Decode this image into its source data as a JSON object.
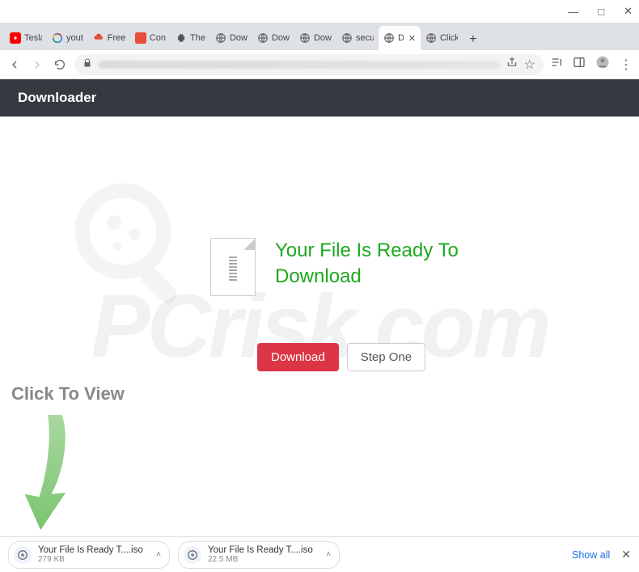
{
  "window": {
    "controls": {
      "min": "—",
      "max": "□",
      "close": "✕"
    }
  },
  "tabs": [
    {
      "title": "Tesla",
      "icon": "youtube"
    },
    {
      "title": "yout",
      "icon": "google"
    },
    {
      "title": "Free",
      "icon": "red-cloud"
    },
    {
      "title": "Con",
      "icon": "red-square"
    },
    {
      "title": "The",
      "icon": "printer"
    },
    {
      "title": "Dow",
      "icon": "globe"
    },
    {
      "title": "Dow",
      "icon": "globe"
    },
    {
      "title": "Dow",
      "icon": "globe"
    },
    {
      "title": "secu",
      "icon": "globe"
    },
    {
      "title": "D",
      "icon": "globe",
      "active": true
    },
    {
      "title": "Click",
      "icon": "globe"
    }
  ],
  "new_tab_label": "+",
  "page": {
    "header_title": "Downloader",
    "heading": "Your File Is Ready To Download",
    "download_btn": "Download",
    "step_one_btn": "Step One",
    "click_to_view": "Click To View",
    "watermark": "PCrisk.com"
  },
  "downloads": {
    "items": [
      {
        "name": "Your File Is Ready T....iso",
        "size": "279 KB"
      },
      {
        "name": "Your File Is Ready T....iso",
        "size": "22.5 MB"
      }
    ],
    "show_all": "Show all"
  }
}
